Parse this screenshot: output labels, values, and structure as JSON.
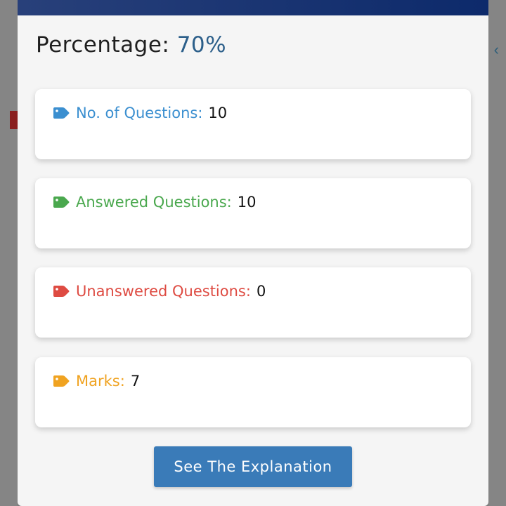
{
  "modal": {
    "percentage_label": "Percentage:",
    "percentage_value": "70%"
  },
  "stats": [
    {
      "label": "No. of Questions:",
      "value": "10",
      "color": "#3b8fd0",
      "icon": "tag-icon"
    },
    {
      "label": "Answered Questions:",
      "value": "10",
      "color": "#4aa84e",
      "icon": "tag-icon"
    },
    {
      "label": "Unanswered Questions:",
      "value": "0",
      "color": "#de4b42",
      "icon": "tag-icon"
    },
    {
      "label": "Marks:",
      "value": "7",
      "color": "#f0a321",
      "icon": "tag-icon"
    }
  ],
  "button": {
    "label": "See The Explanation"
  },
  "background": {
    "chevron": "‹"
  }
}
